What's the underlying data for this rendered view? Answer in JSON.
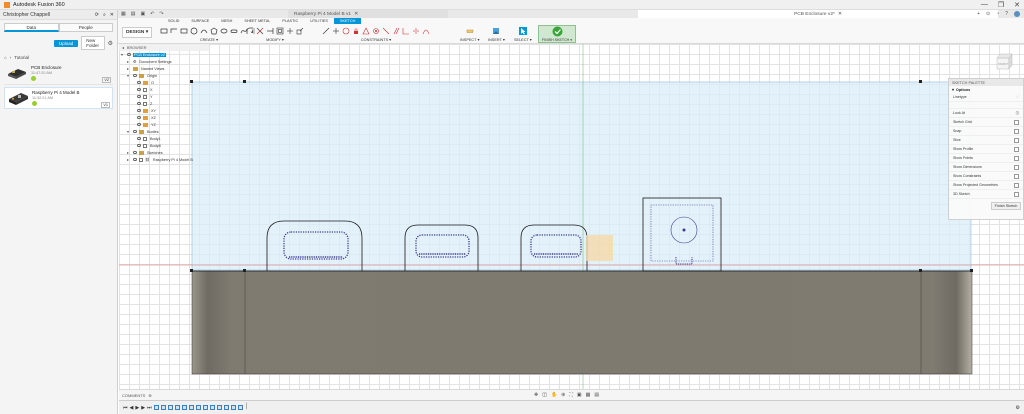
{
  "window": {
    "title": "Autodesk Fusion 360",
    "controls": [
      "—",
      "❐",
      "✕"
    ]
  },
  "left_panel": {
    "account_name": "Christopher Chappell",
    "tabs": [
      "Data",
      "People"
    ],
    "upload_label": "Upload",
    "new_folder_label": "New Folder",
    "breadcrumb": "Tutorial",
    "files": [
      {
        "name": "PCB Enclosure",
        "time": "11:47:20 AM",
        "version": "V2"
      },
      {
        "name": "Raspberry Pi 4 Model B",
        "time": "11:32:21 AM",
        "version": "V1"
      }
    ]
  },
  "doc_tabs": {
    "tab_a": "Raspberry Pi 4 Model B v1",
    "tab_b": "PCB Enclosure v2*"
  },
  "toolbar": {
    "workspace": "DESIGN ▾",
    "tabs": [
      "SOLID",
      "SURFACE",
      "MESH",
      "SHEET METAL",
      "PLASTIC",
      "UTILITIES",
      "SKETCH"
    ],
    "active_tab": "SKETCH",
    "groups": {
      "create": "CREATE ▾",
      "modify": "MODIFY ▾",
      "constraints": "CONSTRAINTS ▾",
      "inspect": "INSPECT ▾",
      "insert": "INSERT ▾",
      "select": "SELECT ▾"
    },
    "finish_sketch": "FINISH SKETCH ▾"
  },
  "browser": {
    "header": "BROWSER",
    "root": "PCB Enclosure v2",
    "nodes": [
      {
        "label": "Document Settings",
        "depth": 1,
        "kind": "gear"
      },
      {
        "label": "Named Views",
        "depth": 1,
        "kind": "folder"
      },
      {
        "label": "Origin",
        "depth": 1,
        "kind": "folder",
        "open": true
      },
      {
        "label": "O",
        "depth": 2,
        "kind": "point"
      },
      {
        "label": "X",
        "depth": 2,
        "kind": "axis"
      },
      {
        "label": "Y",
        "depth": 2,
        "kind": "axis"
      },
      {
        "label": "Z",
        "depth": 2,
        "kind": "axis"
      },
      {
        "label": "XY",
        "depth": 2,
        "kind": "plane"
      },
      {
        "label": "XZ",
        "depth": 2,
        "kind": "plane"
      },
      {
        "label": "YZ",
        "depth": 2,
        "kind": "plane"
      },
      {
        "label": "Bodies",
        "depth": 1,
        "kind": "folder",
        "open": true
      },
      {
        "label": "Body1",
        "depth": 2,
        "kind": "body"
      },
      {
        "label": "Body8",
        "depth": 2,
        "kind": "body"
      },
      {
        "label": "Sketches",
        "depth": 1,
        "kind": "folder"
      },
      {
        "label": "Raspberry Pi 4 Model B",
        "depth": 1,
        "kind": "component"
      }
    ]
  },
  "sketch_palette": {
    "header": "SKETCH PALETTE",
    "section": "Options",
    "rows": [
      "Linetype",
      "Look At",
      "Sketch Grid",
      "Snap",
      "Slice",
      "Show Profile",
      "Show Points",
      "Show Dimensions",
      "Show Constraints",
      "Show Projected Geometries",
      "3D Sketch"
    ],
    "finish_button": "Finish Sketch"
  },
  "viewcube": {
    "face": "FRONT"
  },
  "comments": {
    "label": "COMMENTS"
  },
  "colors": {
    "accent": "#0696d7",
    "sketch_plane": "#d9ecfa",
    "body_gray": "#7e7a70",
    "sketch_line": "#1a1a1a",
    "constraint_point": "#3a3a8c"
  }
}
